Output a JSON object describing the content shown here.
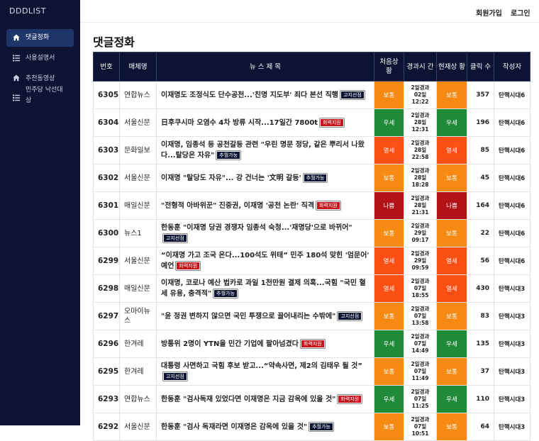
{
  "brand": "DDDLIST",
  "nav": [
    {
      "label": "댓글정화",
      "icon": "home-icon"
    },
    {
      "label": "사용설명서",
      "icon": "list-icon"
    },
    {
      "label": "추천동영상",
      "icon": "home-icon"
    },
    {
      "label1": "민주당 낙선대",
      "label2": "상",
      "icon": "list-icon"
    }
  ],
  "topbar": {
    "signup": "회원가입",
    "login": "로그인"
  },
  "page_title": "댓글정화",
  "columns": [
    "번호",
    "매체명",
    "뉴 스 제 목",
    "처음상 황",
    "경과시 간",
    "현재상 황",
    "클릭 수",
    "작성자"
  ],
  "colors": {
    "navy": "#0d1433",
    "orange": "#f68a12",
    "green": "#1f8a3a",
    "orangered": "#fb4f14",
    "darkred": "#b31217",
    "badge_red": "#c4161c"
  },
  "rows": [
    {
      "num": "6305",
      "media": "연합뉴스",
      "title": "이재명도 조정식도 단수공천...'친명 지도부' 죄다 본선 직행",
      "badge": "고지선점",
      "badge_color": "navy",
      "first": "보통",
      "first_color": "#f68a12",
      "e1": "2일경과",
      "e2": "02일",
      "e3": "12:22",
      "cur": "보통",
      "cur_color": "#f68a12",
      "clicks": "357",
      "author": "탄핵시대6"
    },
    {
      "num": "6304",
      "media": "서울신문",
      "title": "日후쿠시마 오염수 4차 방류 시작...17일간 7800t",
      "badge": "화력지원",
      "badge_color": "red",
      "first": "우세",
      "first_color": "#1f8a3a",
      "e1": "2일경과",
      "e2": "28일",
      "e3": "12:31",
      "cur": "우세",
      "cur_color": "#1f8a3a",
      "clicks": "196",
      "author": "탄핵시대6"
    },
    {
      "num": "6303",
      "media": "문화일보",
      "title": "이재명, 임종석 등 공천갈등 관련 \"우린 명문 정당, 같은 뿌리서 나왔다...탈당은 자유\"",
      "badge": "추월가능",
      "badge_color": "navy",
      "first": "열세",
      "first_color": "#fb4f14",
      "e1": "2일경과",
      "e2": "28일",
      "e3": "22:58",
      "cur": "열세",
      "cur_color": "#fb4f14",
      "clicks": "85",
      "author": "탄핵시대6"
    },
    {
      "num": "6302",
      "media": "서울신문",
      "title": "이재명 \"탈당도 자유\"... 강 건너는 '文明 갈등'",
      "badge": "추월가능",
      "badge_color": "navy",
      "first": "보통",
      "first_color": "#f68a12",
      "e1": "2일경과",
      "e2": "28일",
      "e3": "18:28",
      "cur": "보통",
      "cur_color": "#f68a12",
      "clicks": "45",
      "author": "탄핵시대6"
    },
    {
      "num": "6301",
      "media": "매일신문",
      "title": "\"전형적 아바위꾼\" 진중권, 이재명 '공천 논란' 직격",
      "badge": "화력지원",
      "badge_color": "red",
      "first": "나쁨",
      "first_color": "#b31217",
      "e1": "2일경과",
      "e2": "28일",
      "e3": "21:31",
      "cur": "나쁨",
      "cur_color": "#b31217",
      "clicks": "164",
      "author": "탄핵시대6"
    },
    {
      "num": "6300",
      "media": "뉴스1",
      "title": "한동훈 \"이재명 당권 경쟁자 임종석 숙청...'재명당'으로 바뀌어\"",
      "badge": "고지선점",
      "badge_color": "navy",
      "first": "보통",
      "first_color": "#f68a12",
      "e1": "2일경과",
      "e2": "29일",
      "e3": "09:17",
      "cur": "보통",
      "cur_color": "#f68a12",
      "clicks": "22",
      "author": "탄핵시대6"
    },
    {
      "num": "6299",
      "media": "서울신문",
      "title": "“이재명 가고 조국 온다...100석도 위태” 민주 180석 맞힌 '엄문어' 예언",
      "badge": "화력지원",
      "badge_color": "red",
      "first": "열세",
      "first_color": "#fb4f14",
      "e1": "2일경과",
      "e2": "29일",
      "e3": "09:59",
      "cur": "열세",
      "cur_color": "#fb4f14",
      "clicks": "56",
      "author": "탄핵시대6"
    },
    {
      "num": "6298",
      "media": "매일신문",
      "title": "이재명, 코로나 예산 법카로 과일 1천만원 결제 의혹...국힘 \"국민 혈세 유용, 충격적\"",
      "badge": "추월가능",
      "badge_color": "navy",
      "first": "열세",
      "first_color": "#fb4f14",
      "e1": "2일경과",
      "e2": "07일",
      "e3": "18:55",
      "cur": "열세",
      "cur_color": "#fb4f14",
      "clicks": "430",
      "author": "탄핵시대3"
    },
    {
      "num": "6297",
      "media": "오마이뉴스",
      "title": "\"윤 정권 변하지 않으면 국민 투쟁으로 끌어내리는 수밖에\"",
      "badge": "고지선점",
      "badge_color": "navy",
      "first": "보통",
      "first_color": "#f68a12",
      "e1": "2일경과",
      "e2": "07일",
      "e3": "13:58",
      "cur": "보통",
      "cur_color": "#f68a12",
      "clicks": "83",
      "author": "탄핵시대3"
    },
    {
      "num": "6296",
      "media": "한겨레",
      "title": "방통위 2명이 YTN을 민간 기업에 팔아넘겼다",
      "badge": "화력지원",
      "badge_color": "red",
      "first": "우세",
      "first_color": "#1f8a3a",
      "e1": "2일경과",
      "e2": "07일",
      "e3": "14:49",
      "cur": "우세",
      "cur_color": "#1f8a3a",
      "clicks": "135",
      "author": "탄핵시대3"
    },
    {
      "num": "6295",
      "media": "한겨레",
      "title": "대통령 사면하고 국힘 후보 받고...“약속사면, 제2의 김태우 될 것”",
      "badge": "고지선점",
      "badge_color": "navy",
      "first": "보통",
      "first_color": "#f68a12",
      "e1": "2일경과",
      "e2": "07일",
      "e3": "11:49",
      "cur": "보통",
      "cur_color": "#f68a12",
      "clicks": "37",
      "author": "탄핵시대3"
    },
    {
      "num": "6293",
      "media": "연합뉴스",
      "title": "한동훈 \"검사독재 있었다면 이재명은 지금 감옥에 있을 것\"",
      "badge": "화력지원",
      "badge_color": "red",
      "first": "우세",
      "first_color": "#1f8a3a",
      "e1": "2일경과",
      "e2": "07일",
      "e3": "11:25",
      "cur": "우세",
      "cur_color": "#1f8a3a",
      "clicks": "110",
      "author": "탄핵시대3"
    },
    {
      "num": "6292",
      "media": "서울신문",
      "title": "한동훈 \"검사 독재라면 이재명은 감옥에 있을 것\"",
      "badge": "추월가능",
      "badge_color": "navy",
      "first": "보통",
      "first_color": "#f68a12",
      "e1": "2일경과",
      "e2": "07일",
      "e3": "10:51",
      "cur": "보통",
      "cur_color": "#f68a12",
      "clicks": "64",
      "author": "탄핵시대3"
    }
  ]
}
